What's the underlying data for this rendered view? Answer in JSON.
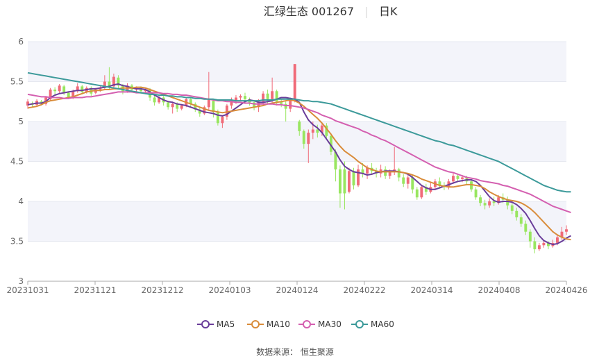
{
  "header": {
    "stock": "汇绿生态 001267",
    "period": "日K"
  },
  "legend": [
    {
      "label": "MA5",
      "color": "#6a3d9a"
    },
    {
      "label": "MA10",
      "color": "#d98c3a"
    },
    {
      "label": "MA30",
      "color": "#d45fb0"
    },
    {
      "label": "MA60",
      "color": "#3c9a9a"
    }
  ],
  "source": "数据来源： 恒生聚源",
  "colors": {
    "up": "#f06a78",
    "down": "#98e65f",
    "band": "#f3f4fa"
  },
  "chart_data": {
    "type": "candlestick",
    "x_ticks": [
      "20231031",
      "20231121",
      "20231212",
      "20240103",
      "20240124",
      "20240222",
      "20240314",
      "20240408",
      "20240426"
    ],
    "y_ticks": [
      "3",
      "3.5",
      "4",
      "4.5",
      "5",
      "5.5",
      "6"
    ],
    "ylim": [
      3,
      6
    ],
    "trading_days": 120,
    "candles": [
      [
        5.2,
        5.25,
        5.16,
        5.28
      ],
      [
        5.23,
        5.21,
        5.18,
        5.25
      ],
      [
        5.21,
        5.26,
        5.19,
        5.28
      ],
      [
        5.25,
        5.22,
        5.2,
        5.27
      ],
      [
        5.22,
        5.3,
        5.2,
        5.32
      ],
      [
        5.28,
        5.4,
        5.26,
        5.42
      ],
      [
        5.4,
        5.38,
        5.34,
        5.43
      ],
      [
        5.38,
        5.45,
        5.35,
        5.47
      ],
      [
        5.44,
        5.36,
        5.33,
        5.46
      ],
      [
        5.36,
        5.3,
        5.28,
        5.38
      ],
      [
        5.3,
        5.38,
        5.28,
        5.4
      ],
      [
        5.38,
        5.44,
        5.36,
        5.48
      ],
      [
        5.44,
        5.37,
        5.34,
        5.46
      ],
      [
        5.37,
        5.42,
        5.35,
        5.44
      ],
      [
        5.42,
        5.35,
        5.32,
        5.44
      ],
      [
        5.36,
        5.4,
        5.34,
        5.42
      ],
      [
        5.4,
        5.42,
        5.37,
        5.45
      ],
      [
        5.42,
        5.5,
        5.4,
        5.58
      ],
      [
        5.5,
        5.44,
        5.4,
        5.68
      ],
      [
        5.44,
        5.56,
        5.42,
        5.6
      ],
      [
        5.55,
        5.45,
        5.4,
        5.58
      ],
      [
        5.45,
        5.38,
        5.34,
        5.47
      ],
      [
        5.38,
        5.45,
        5.36,
        5.48
      ],
      [
        5.45,
        5.4,
        5.36,
        5.47
      ],
      [
        5.4,
        5.42,
        5.37,
        5.44
      ],
      [
        5.42,
        5.38,
        5.35,
        5.44
      ],
      [
        5.38,
        5.4,
        5.35,
        5.42
      ],
      [
        5.4,
        5.3,
        5.26,
        5.42
      ],
      [
        5.3,
        5.24,
        5.2,
        5.32
      ],
      [
        5.24,
        5.3,
        5.22,
        5.32
      ],
      [
        5.3,
        5.24,
        5.2,
        5.32
      ],
      [
        5.24,
        5.18,
        5.15,
        5.26
      ],
      [
        5.18,
        5.22,
        5.1,
        5.25
      ],
      [
        5.22,
        5.16,
        5.12,
        5.24
      ],
      [
        5.16,
        5.2,
        5.14,
        5.22
      ],
      [
        5.2,
        5.28,
        5.18,
        5.3
      ],
      [
        5.28,
        5.22,
        5.18,
        5.3
      ],
      [
        5.22,
        5.15,
        5.12,
        5.24
      ],
      [
        5.15,
        5.1,
        5.06,
        5.17
      ],
      [
        5.1,
        5.18,
        5.08,
        5.2
      ],
      [
        5.18,
        5.28,
        5.14,
        5.62
      ],
      [
        5.26,
        5.12,
        5.05,
        5.28
      ],
      [
        5.12,
        4.98,
        4.95,
        5.15
      ],
      [
        4.98,
        5.06,
        4.92,
        5.08
      ],
      [
        5.06,
        5.2,
        5.02,
        5.22
      ],
      [
        5.2,
        5.26,
        5.16,
        5.3
      ],
      [
        5.26,
        5.3,
        5.22,
        5.33
      ],
      [
        5.3,
        5.32,
        5.26,
        5.34
      ],
      [
        5.32,
        5.28,
        5.22,
        5.36
      ],
      [
        5.28,
        5.24,
        5.2,
        5.3
      ],
      [
        5.24,
        5.18,
        5.14,
        5.26
      ],
      [
        5.18,
        5.25,
        5.12,
        5.28
      ],
      [
        5.25,
        5.35,
        5.2,
        5.38
      ],
      [
        5.35,
        5.28,
        5.22,
        5.4
      ],
      [
        5.28,
        5.38,
        5.24,
        5.55
      ],
      [
        5.38,
        5.25,
        5.2,
        5.4
      ],
      [
        5.25,
        5.22,
        5.18,
        5.28
      ],
      [
        5.22,
        5.16,
        5.0,
        5.25
      ],
      [
        5.16,
        5.28,
        5.12,
        5.3
      ],
      [
        5.28,
        5.72,
        5.24,
        5.72
      ],
      [
        5.0,
        4.88,
        4.82,
        5.02
      ],
      [
        4.88,
        4.72,
        4.66,
        4.9
      ],
      [
        4.72,
        4.86,
        4.48,
        4.9
      ],
      [
        4.86,
        4.9,
        4.78,
        5.0
      ],
      [
        4.9,
        4.86,
        4.8,
        4.96
      ],
      [
        4.86,
        4.95,
        4.82,
        4.98
      ],
      [
        4.95,
        4.82,
        4.78,
        4.98
      ],
      [
        4.82,
        4.62,
        4.58,
        4.85
      ],
      [
        4.62,
        4.4,
        4.25,
        4.65
      ],
      [
        4.4,
        4.1,
        3.92,
        4.45
      ],
      [
        4.4,
        4.1,
        3.9,
        4.5
      ],
      [
        4.12,
        4.38,
        4.1,
        4.42
      ],
      [
        4.38,
        4.2,
        4.15,
        4.42
      ],
      [
        4.2,
        4.4,
        4.18,
        4.46
      ],
      [
        4.4,
        4.35,
        4.3,
        4.48
      ],
      [
        4.35,
        4.42,
        4.28,
        4.45
      ],
      [
        4.42,
        4.38,
        4.34,
        4.48
      ],
      [
        4.38,
        4.35,
        4.3,
        4.42
      ],
      [
        4.35,
        4.4,
        4.3,
        4.46
      ],
      [
        4.4,
        4.32,
        4.28,
        4.44
      ],
      [
        4.32,
        4.38,
        4.28,
        4.4
      ],
      [
        4.38,
        4.4,
        4.33,
        4.68
      ],
      [
        4.4,
        4.3,
        4.25,
        4.42
      ],
      [
        4.3,
        4.22,
        4.18,
        4.34
      ],
      [
        4.22,
        4.3,
        4.16,
        4.33
      ],
      [
        4.3,
        4.15,
        4.1,
        4.32
      ],
      [
        4.15,
        4.05,
        4.02,
        4.18
      ],
      [
        4.05,
        4.18,
        4.03,
        4.2
      ],
      [
        4.18,
        4.12,
        4.08,
        4.22
      ],
      [
        4.12,
        4.18,
        4.1,
        4.24
      ],
      [
        4.18,
        4.25,
        4.14,
        4.28
      ],
      [
        4.25,
        4.2,
        4.16,
        4.3
      ],
      [
        4.2,
        4.18,
        4.14,
        4.24
      ],
      [
        4.18,
        4.25,
        4.15,
        4.28
      ],
      [
        4.25,
        4.32,
        4.22,
        4.35
      ],
      [
        4.32,
        4.28,
        4.24,
        4.35
      ],
      [
        4.28,
        4.3,
        4.24,
        4.33
      ],
      [
        4.3,
        4.25,
        4.2,
        4.32
      ],
      [
        4.25,
        4.15,
        4.12,
        4.28
      ],
      [
        4.15,
        4.05,
        4.02,
        4.18
      ],
      [
        4.05,
        3.98,
        3.94,
        4.08
      ],
      [
        3.98,
        3.95,
        3.9,
        4.02
      ],
      [
        3.95,
        4.0,
        3.92,
        4.04
      ],
      [
        4.0,
        3.98,
        3.94,
        4.06
      ],
      [
        3.98,
        4.05,
        3.96,
        4.08
      ],
      [
        4.05,
        4.02,
        3.98,
        4.1
      ],
      [
        4.02,
        3.95,
        3.9,
        4.06
      ],
      [
        3.95,
        3.88,
        3.84,
        3.98
      ],
      [
        3.88,
        3.8,
        3.76,
        3.92
      ],
      [
        3.8,
        3.72,
        3.68,
        3.84
      ],
      [
        3.72,
        3.62,
        3.58,
        3.76
      ],
      [
        3.62,
        3.5,
        3.42,
        3.65
      ],
      [
        3.5,
        3.4,
        3.35,
        3.55
      ],
      [
        3.4,
        3.45,
        3.38,
        3.48
      ],
      [
        3.45,
        3.48,
        3.42,
        3.52
      ],
      [
        3.48,
        3.44,
        3.4,
        3.5
      ],
      [
        3.44,
        3.48,
        3.42,
        3.52
      ],
      [
        3.48,
        3.55,
        3.45,
        3.58
      ],
      [
        3.55,
        3.62,
        3.52,
        3.68
      ],
      [
        3.62,
        3.65,
        3.58,
        3.7
      ]
    ],
    "series": [
      {
        "name": "MA5",
        "values": [
          5.21,
          5.22,
          5.23,
          5.23,
          5.25,
          5.3,
          5.33,
          5.35,
          5.36,
          5.37,
          5.38,
          5.39,
          5.39,
          5.4,
          5.41,
          5.41,
          5.42,
          5.43,
          5.44,
          5.46,
          5.47,
          5.45,
          5.44,
          5.42,
          5.41,
          5.41,
          5.4,
          5.37,
          5.33,
          5.3,
          5.27,
          5.25,
          5.24,
          5.22,
          5.21,
          5.2,
          5.18,
          5.16,
          5.14,
          5.12,
          5.11,
          5.1,
          5.08,
          5.07,
          5.09,
          5.13,
          5.17,
          5.21,
          5.25,
          5.27,
          5.26,
          5.24,
          5.24,
          5.25,
          5.26,
          5.28,
          5.3,
          5.3,
          5.29,
          5.28,
          5.24,
          5.12,
          5.02,
          4.96,
          4.92,
          4.86,
          4.78,
          4.7,
          4.62,
          4.52,
          4.44,
          4.4,
          4.37,
          4.36,
          4.35,
          4.33,
          4.34,
          4.36,
          4.37,
          4.38,
          4.38,
          4.38,
          4.37,
          4.36,
          4.34,
          4.3,
          4.25,
          4.2,
          4.17,
          4.15,
          4.15,
          4.17,
          4.19,
          4.21,
          4.23,
          4.25,
          4.26,
          4.27,
          4.27,
          4.25,
          4.2,
          4.13,
          4.06,
          4.01,
          3.99,
          4.0,
          4.0,
          3.99,
          3.96,
          3.91,
          3.85,
          3.76,
          3.66,
          3.57,
          3.51,
          3.48,
          3.46,
          3.47,
          3.5,
          3.54,
          3.57
        ]
      },
      {
        "name": "MA10",
        "values": [
          5.17,
          5.18,
          5.19,
          5.21,
          5.24,
          5.26,
          5.27,
          5.28,
          5.29,
          5.3,
          5.31,
          5.33,
          5.35,
          5.37,
          5.38,
          5.39,
          5.39,
          5.4,
          5.4,
          5.41,
          5.41,
          5.42,
          5.42,
          5.42,
          5.43,
          5.43,
          5.42,
          5.4,
          5.38,
          5.36,
          5.34,
          5.32,
          5.3,
          5.28,
          5.26,
          5.24,
          5.22,
          5.2,
          5.18,
          5.16,
          5.14,
          5.13,
          5.12,
          5.11,
          5.12,
          5.13,
          5.14,
          5.15,
          5.16,
          5.17,
          5.18,
          5.19,
          5.2,
          5.22,
          5.23,
          5.24,
          5.25,
          5.26,
          5.27,
          5.26,
          5.23,
          5.19,
          5.14,
          5.09,
          5.04,
          4.98,
          4.91,
          4.84,
          4.76,
          4.69,
          4.63,
          4.59,
          4.55,
          4.5,
          4.46,
          4.42,
          4.4,
          4.38,
          4.37,
          4.37,
          4.37,
          4.37,
          4.37,
          4.36,
          4.35,
          4.33,
          4.31,
          4.28,
          4.26,
          4.24,
          4.22,
          4.2,
          4.19,
          4.18,
          4.18,
          4.19,
          4.2,
          4.21,
          4.21,
          4.2,
          4.19,
          4.16,
          4.12,
          4.09,
          4.06,
          4.04,
          4.02,
          4.01,
          4.0,
          3.98,
          3.95,
          3.91,
          3.86,
          3.8,
          3.74,
          3.68,
          3.62,
          3.58,
          3.55,
          3.53,
          3.52
        ]
      },
      {
        "name": "MA30",
        "values": [
          5.34,
          5.33,
          5.32,
          5.31,
          5.31,
          5.3,
          5.3,
          5.3,
          5.29,
          5.29,
          5.3,
          5.3,
          5.3,
          5.31,
          5.31,
          5.32,
          5.33,
          5.34,
          5.35,
          5.36,
          5.37,
          5.37,
          5.37,
          5.37,
          5.36,
          5.36,
          5.36,
          5.36,
          5.36,
          5.36,
          5.35,
          5.35,
          5.34,
          5.34,
          5.33,
          5.33,
          5.32,
          5.31,
          5.3,
          5.29,
          5.28,
          5.27,
          5.26,
          5.26,
          5.25,
          5.25,
          5.24,
          5.24,
          5.23,
          5.23,
          5.22,
          5.22,
          5.22,
          5.22,
          5.22,
          5.21,
          5.21,
          5.2,
          5.2,
          5.19,
          5.18,
          5.17,
          5.15,
          5.13,
          5.11,
          5.08,
          5.06,
          5.04,
          5.01,
          4.99,
          4.97,
          4.95,
          4.93,
          4.91,
          4.88,
          4.86,
          4.83,
          4.81,
          4.78,
          4.76,
          4.73,
          4.7,
          4.67,
          4.64,
          4.61,
          4.58,
          4.55,
          4.52,
          4.49,
          4.46,
          4.43,
          4.41,
          4.39,
          4.37,
          4.36,
          4.34,
          4.32,
          4.3,
          4.29,
          4.28,
          4.26,
          4.25,
          4.24,
          4.23,
          4.22,
          4.2,
          4.19,
          4.17,
          4.15,
          4.13,
          4.11,
          4.09,
          4.06,
          4.03,
          4.0,
          3.97,
          3.94,
          3.92,
          3.9,
          3.88,
          3.86
        ]
      },
      {
        "name": "MA60",
        "values": [
          5.61,
          5.6,
          5.59,
          5.58,
          5.57,
          5.56,
          5.55,
          5.54,
          5.53,
          5.52,
          5.51,
          5.5,
          5.49,
          5.48,
          5.47,
          5.46,
          5.45,
          5.44,
          5.43,
          5.42,
          5.41,
          5.4,
          5.39,
          5.38,
          5.37,
          5.36,
          5.35,
          5.34,
          5.34,
          5.33,
          5.33,
          5.32,
          5.32,
          5.31,
          5.31,
          5.3,
          5.3,
          5.29,
          5.29,
          5.28,
          5.28,
          5.28,
          5.27,
          5.27,
          5.27,
          5.27,
          5.26,
          5.26,
          5.26,
          5.26,
          5.26,
          5.26,
          5.27,
          5.27,
          5.27,
          5.28,
          5.28,
          5.28,
          5.28,
          5.28,
          5.27,
          5.26,
          5.26,
          5.25,
          5.25,
          5.24,
          5.23,
          5.22,
          5.2,
          5.18,
          5.16,
          5.14,
          5.12,
          5.1,
          5.08,
          5.06,
          5.04,
          5.02,
          5.0,
          4.98,
          4.96,
          4.94,
          4.92,
          4.9,
          4.88,
          4.86,
          4.84,
          4.82,
          4.8,
          4.78,
          4.76,
          4.75,
          4.73,
          4.71,
          4.7,
          4.68,
          4.66,
          4.64,
          4.62,
          4.6,
          4.58,
          4.56,
          4.54,
          4.52,
          4.5,
          4.47,
          4.44,
          4.41,
          4.38,
          4.35,
          4.32,
          4.29,
          4.26,
          4.23,
          4.2,
          4.18,
          4.16,
          4.14,
          4.13,
          4.12,
          4.12
        ]
      }
    ]
  }
}
